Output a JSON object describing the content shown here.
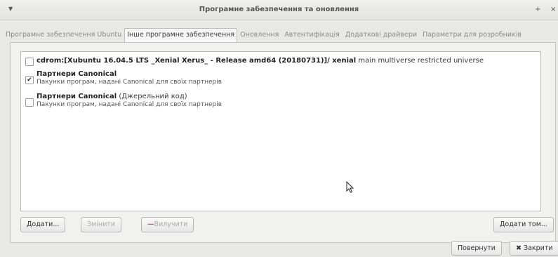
{
  "window": {
    "title": "Програмне забезпечення та оновлення",
    "menu_icon": "chevron-down-icon",
    "controls": [
      "+",
      "×"
    ]
  },
  "tabs": [
    {
      "label": "Програмне забезпечення Ubuntu",
      "active": false
    },
    {
      "label": "Інше програмне забезпечення",
      "active": true
    },
    {
      "label": "Оновлення",
      "active": false
    },
    {
      "label": "Автентифікація",
      "active": false
    },
    {
      "label": "Додаткові драйвери",
      "active": false
    },
    {
      "label": "Параметри для розробників",
      "active": false
    }
  ],
  "sources": [
    {
      "checked": false,
      "bold": "cdrom:[Xubuntu 16.04.5 LTS _Xenial Xerus_ - Release amd64 (20180731)]/ xenial",
      "normal": " main multiverse restricted universe",
      "sub": ""
    },
    {
      "checked": true,
      "bold": "Партнери Canonical",
      "normal": "",
      "sub": "Пакунки програм, надані Canonical для своїх партнерів"
    },
    {
      "checked": false,
      "bold": "Партнери Canonical",
      "normal": " (Джерельний код)",
      "sub": "Пакунки програм, надані Canonical для своїх партнерів"
    }
  ],
  "buttons": {
    "add": "Додати...",
    "edit": "Змінити",
    "remove": "Вилучити",
    "add_volume": "Додати том..."
  },
  "footer": {
    "revert": "Повернути",
    "close_symbol": "✖",
    "close": "Закрити"
  }
}
